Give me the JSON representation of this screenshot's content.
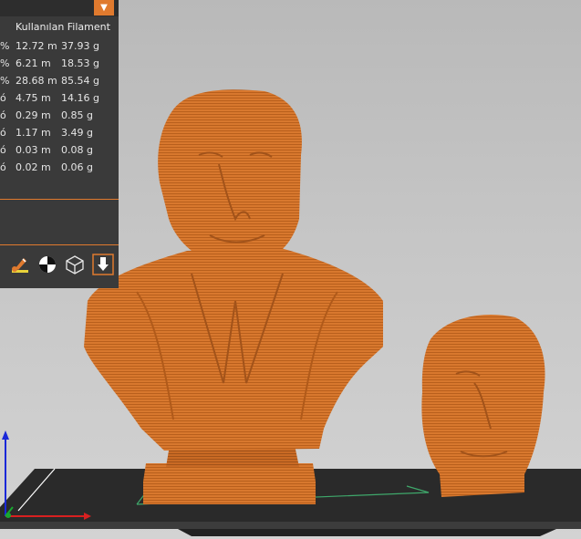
{
  "panel": {
    "header": "Kullanılan Filament",
    "rows": [
      {
        "pct": "%",
        "length": "12.72 m",
        "weight": "37.93 g"
      },
      {
        "pct": "%",
        "length": "6.21 m",
        "weight": "18.53 g"
      },
      {
        "pct": "%",
        "length": "28.68 m",
        "weight": "85.54 g"
      },
      {
        "pct": "ó",
        "length": "4.75 m",
        "weight": "14.16 g"
      },
      {
        "pct": "ó",
        "length": "0.29 m",
        "weight": "0.85 g"
      },
      {
        "pct": "ó",
        "length": "1.17 m",
        "weight": "3.49 g"
      },
      {
        "pct": "ó",
        "length": "0.03 m",
        "weight": "0.08 g"
      },
      {
        "pct": "ó",
        "length": "0.02 m",
        "weight": "0.06 g"
      }
    ],
    "dropdown_icon": "triangle-down-icon"
  },
  "toolbar": {
    "tools": [
      "paint-brush-icon",
      "seam-circle-icon",
      "wireframe-cube-icon",
      "export-download-icon"
    ]
  },
  "colors": {
    "accent": "#e07a2e",
    "model": "#d8782e",
    "panel": "#3a3a3a",
    "bed": "#2f2f2f"
  }
}
